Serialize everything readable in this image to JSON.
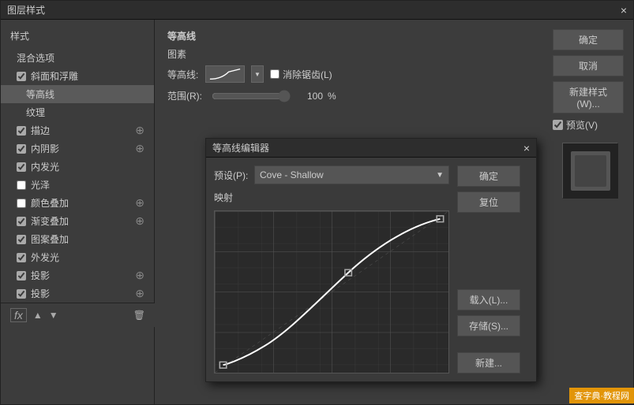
{
  "mainDialog": {
    "title": "图层样式",
    "closeLabel": "×"
  },
  "sidebar": {
    "topLabel": "样式",
    "items": [
      {
        "id": "blend-options",
        "label": "混合选项",
        "checked": null,
        "indent": false,
        "hasPlus": false
      },
      {
        "id": "bevel-emboss",
        "label": "斜面和浮雕",
        "checked": true,
        "indent": false,
        "hasPlus": false
      },
      {
        "id": "contour",
        "label": "等高线",
        "checked": null,
        "indent": true,
        "hasPlus": false,
        "active": true
      },
      {
        "id": "texture",
        "label": "纹理",
        "checked": null,
        "indent": true,
        "hasPlus": false
      },
      {
        "id": "stroke",
        "label": "描边",
        "checked": true,
        "indent": false,
        "hasPlus": true
      },
      {
        "id": "inner-shadow",
        "label": "内阴影",
        "checked": true,
        "indent": false,
        "hasPlus": true
      },
      {
        "id": "inner-glow",
        "label": "内发光",
        "checked": true,
        "indent": false,
        "hasPlus": false
      },
      {
        "id": "satin",
        "label": "光泽",
        "checked": null,
        "indent": false,
        "hasPlus": false
      },
      {
        "id": "color-overlay",
        "label": "颜色叠加",
        "checked": null,
        "indent": false,
        "hasPlus": true
      },
      {
        "id": "gradient-overlay",
        "label": "渐变叠加",
        "checked": true,
        "indent": false,
        "hasPlus": true
      },
      {
        "id": "pattern-overlay",
        "label": "图案叠加",
        "checked": true,
        "indent": false,
        "hasPlus": false
      },
      {
        "id": "outer-glow",
        "label": "外发光",
        "checked": true,
        "indent": false,
        "hasPlus": false
      },
      {
        "id": "drop-shadow1",
        "label": "投影",
        "checked": true,
        "indent": false,
        "hasPlus": true
      },
      {
        "id": "drop-shadow2",
        "label": "投影",
        "checked": true,
        "indent": false,
        "hasPlus": true
      }
    ]
  },
  "mainContent": {
    "sectionTitle": "等高线",
    "subTitle": "图素",
    "contourLabel": "等高线:",
    "antiAliasLabel": "消除锯齿(L)",
    "rangeLabel": "范围(R):",
    "rangeValue": "100",
    "rangePercent": "%"
  },
  "rightPanel": {
    "confirmBtn": "确定",
    "cancelBtn": "取消",
    "newStyleBtn": "新建样式(W)...",
    "previewLabel": "预览(V)",
    "previewChecked": true
  },
  "contourEditor": {
    "title": "等高线编辑器",
    "closeLabel": "×",
    "presetLabel": "预设(P):",
    "presetValue": "Cove - Shallow",
    "mappingLabel": "映射",
    "confirmBtn": "确定",
    "resetBtn": "复位",
    "loadBtn": "载入(L)...",
    "saveBtn": "存储(S)...",
    "newBtn": "新建..."
  },
  "watermark": "查字典·教程网",
  "colors": {
    "accent": "#3a7ed5",
    "dialogBg": "#3c3c3c",
    "titleBg": "#2d2d2d",
    "btnBg": "#555555",
    "activeSidebar": "#5a5a5a"
  }
}
